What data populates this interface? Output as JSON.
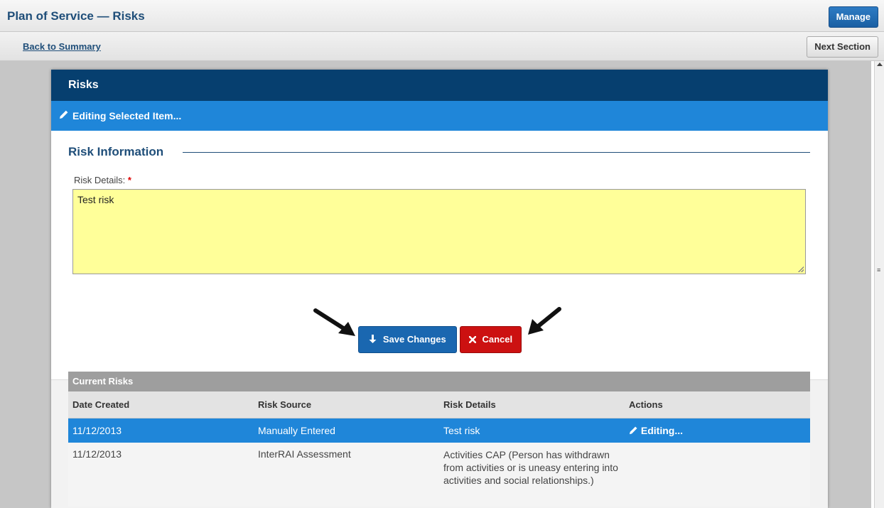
{
  "header": {
    "title": "Plan of Service — Risks",
    "manage_label": "Manage"
  },
  "subbar": {
    "back_label": "Back to Summary",
    "next_label": "Next Section"
  },
  "panel": {
    "title": "Risks",
    "edit_banner": "Editing Selected Item...",
    "section_legend": "Risk Information",
    "field_label": "Risk Details:",
    "required_mark": "*",
    "field_value": "Test risk",
    "save_label": "Save Changes",
    "cancel_label": "Cancel"
  },
  "table": {
    "title": "Current Risks",
    "columns": [
      "Date Created",
      "Risk Source",
      "Risk Details",
      "Actions"
    ],
    "rows": [
      {
        "date": "11/12/2013",
        "source": "Manually Entered",
        "details": "Test risk",
        "action": "Editing..."
      },
      {
        "date": "11/12/2013",
        "source": "InterRAI Assessment",
        "details": "Activities CAP (Person has withdrawn from activities or is uneasy entering into activities and social relationships.)",
        "action": ""
      }
    ]
  },
  "colors": {
    "panel_header": "#063f6f",
    "edit_banner": "#1f86d9",
    "save_button": "#1a67b0",
    "cancel_button": "#cc1111",
    "textarea_bg": "#ffff99"
  }
}
